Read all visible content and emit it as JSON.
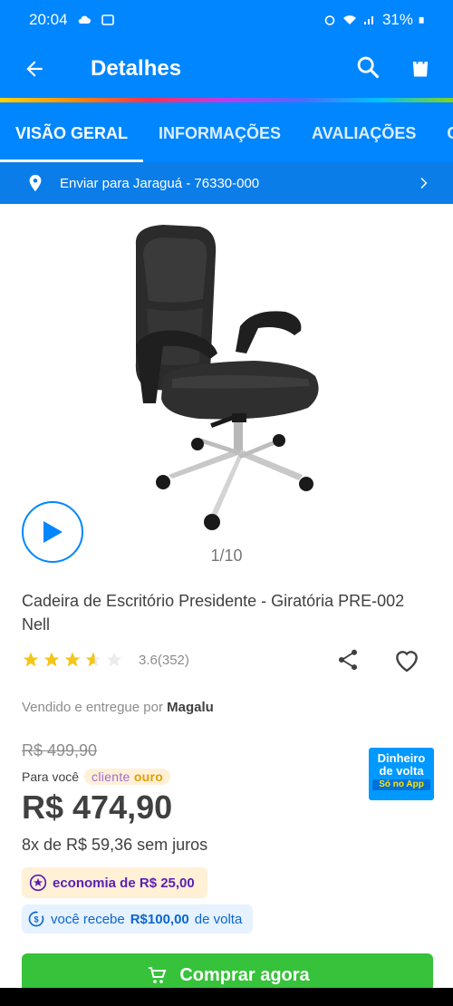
{
  "status_bar": {
    "time": "20:04",
    "battery": "31%"
  },
  "header": {
    "title": "Detalhes"
  },
  "tabs": [
    {
      "label": "VISÃO GERAL"
    },
    {
      "label": "INFORMAÇÕES"
    },
    {
      "label": "AVALIAÇÕES"
    },
    {
      "label": "C"
    }
  ],
  "shipping": {
    "text": "Enviar para Jaraguá - 76330-000"
  },
  "gallery": {
    "pager": "1/10"
  },
  "product": {
    "title": "Cadeira de Escritório Presidente  - Giratória PRE-002 Nell",
    "rating_value": 3.6,
    "rating_text": "3.6(352)",
    "seller_prefix": "Vendido e entregue por",
    "seller_name": "Magalu"
  },
  "pricing": {
    "old_price": "R$ 499,90",
    "para_voce": "Para você",
    "cliente_label": "cliente",
    "ouro_label": "ouro",
    "price": "R$ 474,90",
    "installments": "8x de R$ 59,36 sem juros",
    "economy": "economia de R$ 25,00",
    "cashback_prefix": "você recebe",
    "cashback_amount": "R$100,00",
    "cashback_suffix": "de volta"
  },
  "cashback_badge": {
    "line1": "Dinheiro",
    "line2": "de volta",
    "line3": "Só no App"
  },
  "buy_button": {
    "label": "Comprar agora"
  },
  "colors": {
    "primary": "#0086ff",
    "buy": "#36c23a",
    "star": "#f5c518",
    "economy_text": "#5b1fb5"
  }
}
